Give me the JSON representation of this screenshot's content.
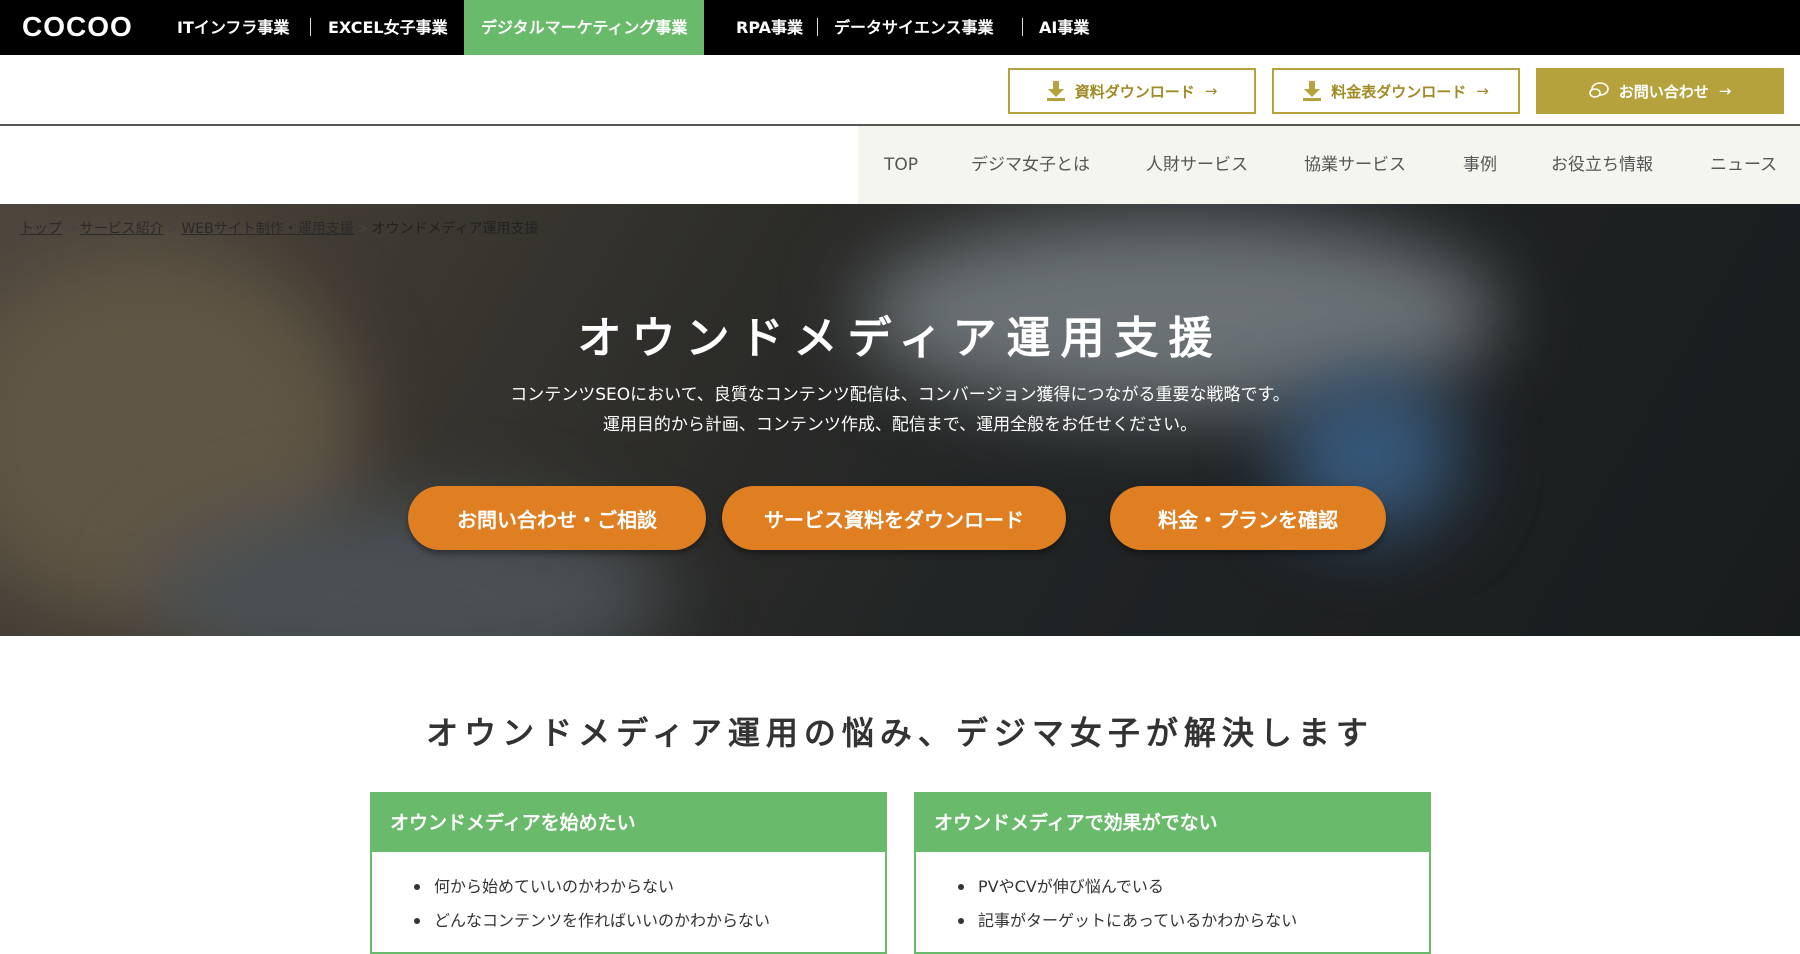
{
  "brand": {
    "logo": "COCOO"
  },
  "business_nav": {
    "items": [
      {
        "label": "ITインフラ事業"
      },
      {
        "label": "EXCEL女子事業"
      },
      {
        "label": "デジタルマーケティング事業",
        "active": true
      },
      {
        "label": "RPA事業"
      },
      {
        "label": "データサイエンス事業"
      },
      {
        "label": "AI事業"
      }
    ]
  },
  "utility": {
    "download_doc": "資料ダウンロード",
    "download_price": "料金表ダウンロード",
    "contact": "お問い合わせ",
    "arrow": "→"
  },
  "global_nav": {
    "items": [
      {
        "label": "TOP"
      },
      {
        "label": "デジマ女子とは"
      },
      {
        "label": "人財サービス"
      },
      {
        "label": "協業サービス"
      },
      {
        "label": "事例"
      },
      {
        "label": "お役立ち情報"
      },
      {
        "label": "ニュース"
      }
    ]
  },
  "breadcrumb": {
    "items": [
      {
        "label": "トップ"
      },
      {
        "label": "サービス紹介"
      },
      {
        "label": "WEBサイト制作・運用支援"
      },
      {
        "label": "オウンドメディア運用支援"
      }
    ],
    "separator": ">"
  },
  "hero": {
    "title": "オウンドメディア運用支援",
    "desc_line1": "コンテンツSEOにおいて、良質なコンテンツ配信は、コンバージョン獲得につながる重要な戦略です。",
    "desc_line2": "運用目的から計画、コンテンツ作成、配信まで、運用全般をお任せください。",
    "cta_contact": "お問い合わせ・ご相談",
    "cta_download": "サービス資料をダウンロード",
    "cta_price": "料金・プランを確認"
  },
  "worries": {
    "title": "オウンドメディア運用の悩み、デジマ女子が解決します",
    "cards": [
      {
        "heading": "オウンドメディアを始めたい",
        "items": [
          "何から始めていいのかわからない",
          "どんなコンテンツを作ればいいのかわからない"
        ]
      },
      {
        "heading": "オウンドメディアで効果がでない",
        "items": [
          "PVやCVが伸び悩んでいる",
          "記事がターゲットにあっているかわからない"
        ]
      }
    ]
  },
  "colors": {
    "green": "#6aba6b",
    "gold": "#b5a23c",
    "orange": "#e07f22",
    "black": "#000000"
  },
  "icons": {
    "download": "download-icon",
    "contact": "chat-bubble-icon"
  }
}
